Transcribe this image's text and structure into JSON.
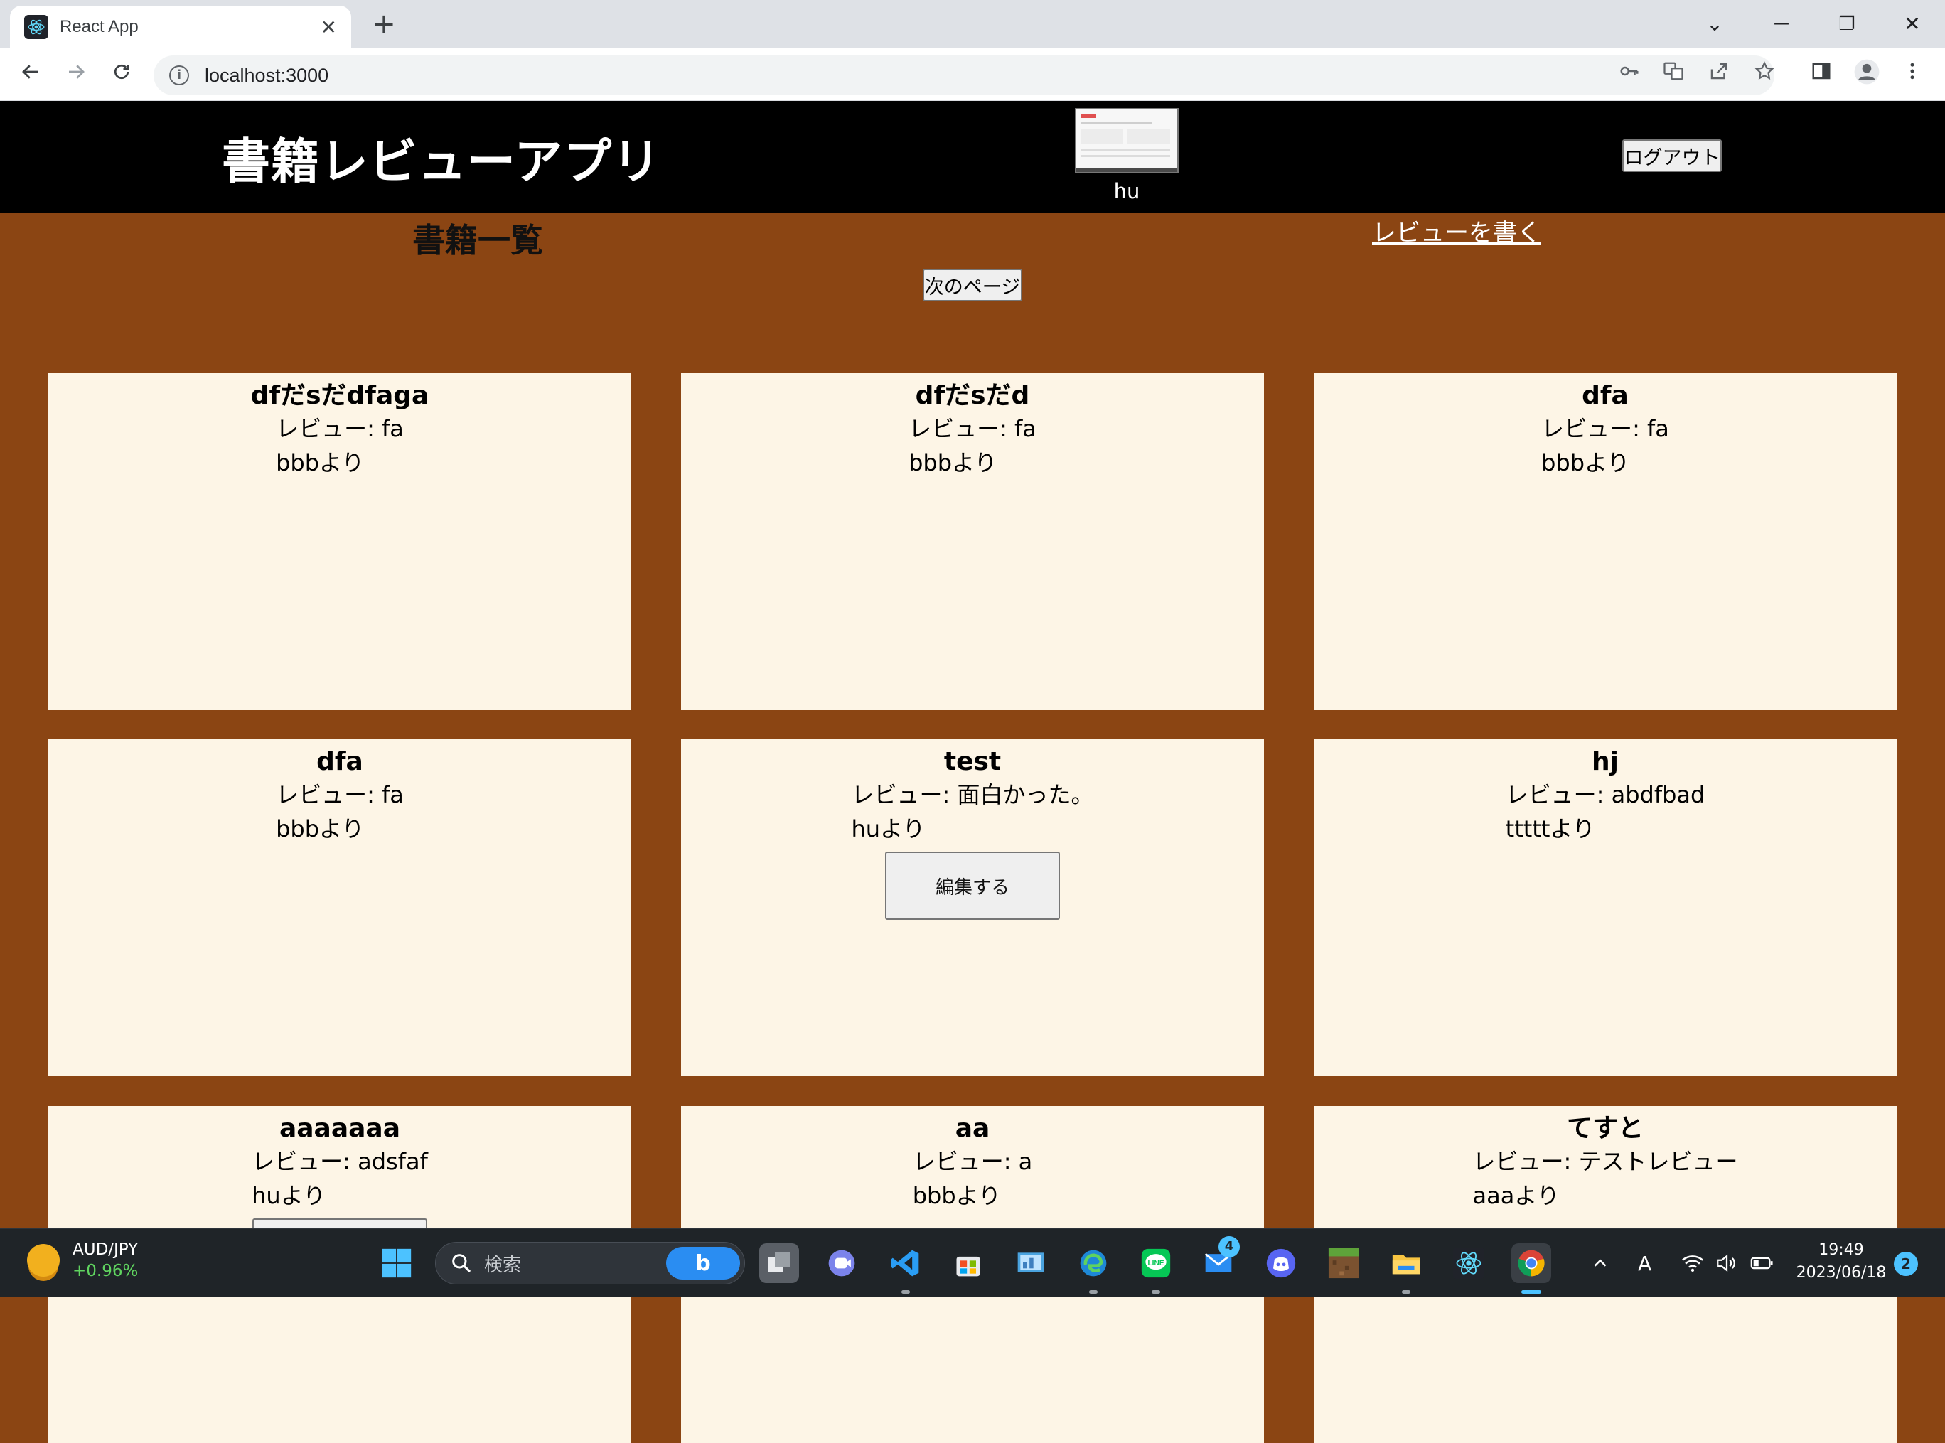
{
  "browser": {
    "tab_title": "React App",
    "tab_close": "✕",
    "new_tab": "+",
    "url": "localhost:3000",
    "controls": {
      "dropdown": "⌄",
      "minimize": "—",
      "restore": "❐",
      "close": "✕"
    }
  },
  "header": {
    "app_title": "書籍レビューアプリ",
    "user_name": "hu",
    "logout_label": "ログアウト"
  },
  "page": {
    "heading": "書籍一覧",
    "write_review_link": "レビューを書く",
    "next_page_label": "次のページ"
  },
  "books": [
    {
      "title": "dfだsだdfaga",
      "review": "レビュー: fa",
      "reviewer": "bbbより"
    },
    {
      "title": "dfだsだd",
      "review": "レビュー: fa",
      "reviewer": "bbbより"
    },
    {
      "title": "dfa",
      "review": "レビュー: fa",
      "reviewer": "bbbより"
    },
    {
      "title": "dfa",
      "review": "レビュー: fa",
      "reviewer": "bbbより"
    },
    {
      "title": "test",
      "review": "レビュー: 面白かった。",
      "reviewer": "huより",
      "edit_label": "編集する"
    },
    {
      "title": "hj",
      "review": "レビュー: abdfbad",
      "reviewer": "tttttより"
    },
    {
      "title": "aaaaaaa",
      "review": "レビュー: adsfaf",
      "reviewer": "huより",
      "edit_label": ""
    },
    {
      "title": "aa",
      "review": "レビュー: a",
      "reviewer": "bbbより"
    },
    {
      "title": "てすと",
      "review": "レビュー: テストレビュー",
      "reviewer": "aaaより"
    }
  ],
  "taskbar": {
    "ticker_name": "AUD/JPY",
    "ticker_change": "+0.96%",
    "search_placeholder": "検索",
    "bing_label": "b",
    "mail_badge": "4",
    "ime_label": "A",
    "time": "19:49",
    "date": "2023/06/18",
    "notifications": "2"
  },
  "colors": {
    "page_background": "#8b4513",
    "header_background": "#000000",
    "card_background": "#fdf5e6"
  }
}
